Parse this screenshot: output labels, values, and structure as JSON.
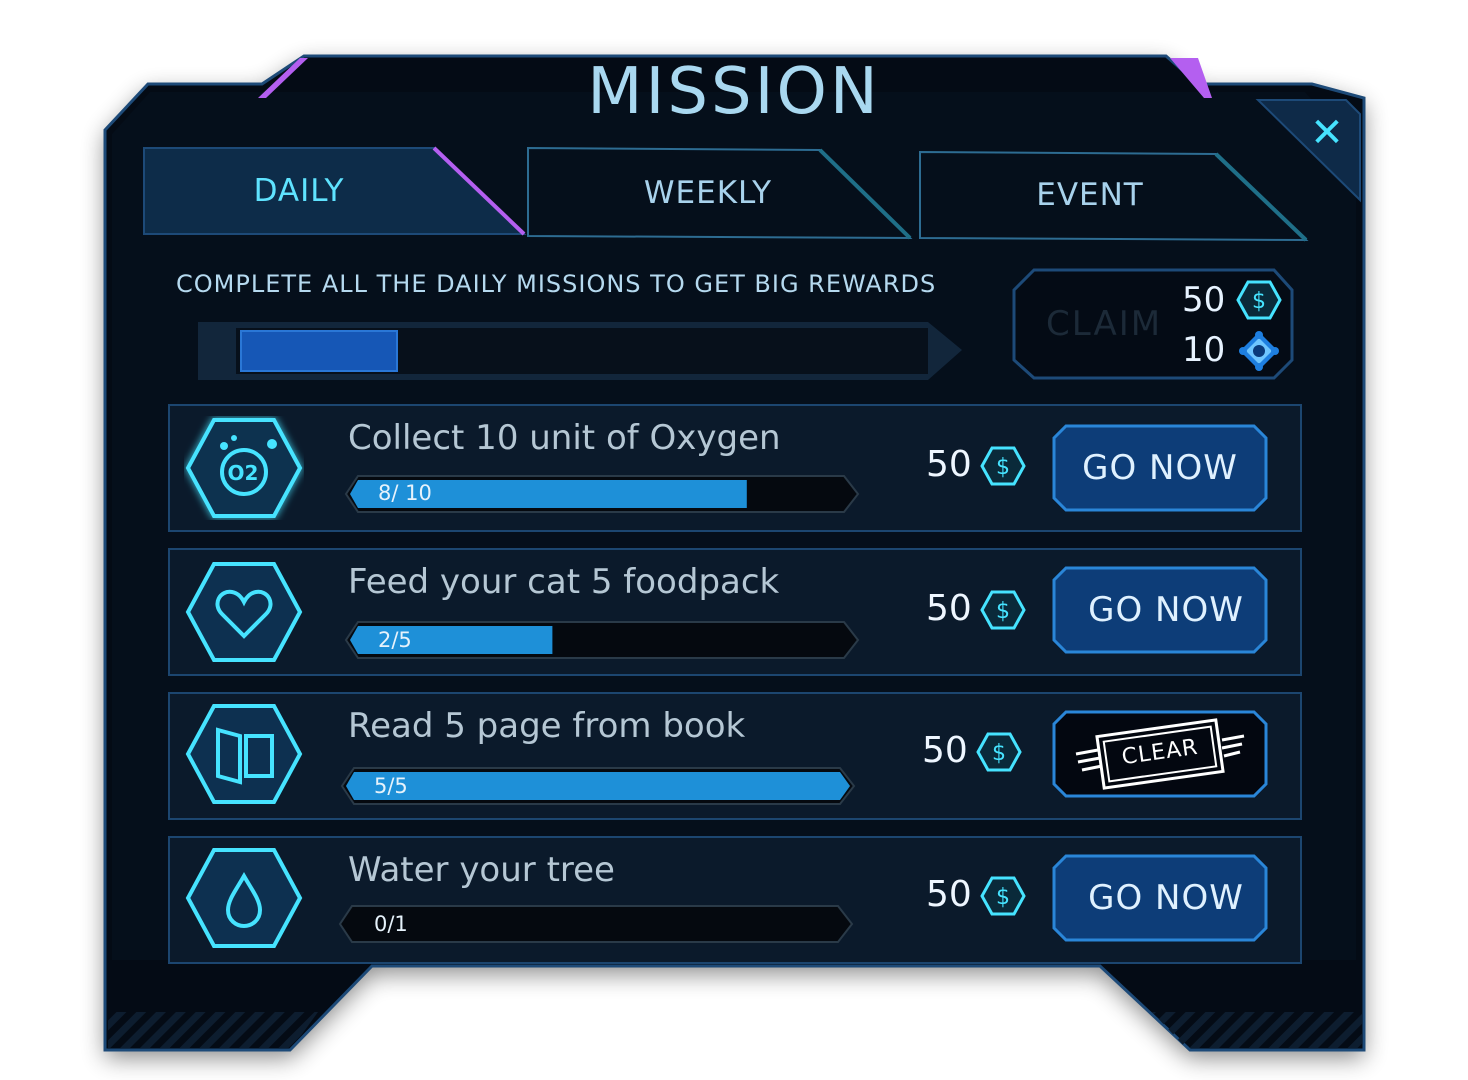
{
  "title": "MISSION",
  "close_icon": "close-icon",
  "tabs": [
    {
      "label": "DAILY",
      "active": true
    },
    {
      "label": "WEEKLY",
      "active": false
    },
    {
      "label": "EVENT",
      "active": false
    }
  ],
  "daily_banner": {
    "text": "COMPLETE ALL THE DAILY MISSIONS TO GET BIG REWARDS",
    "progress": 0.23
  },
  "claim": {
    "label": "CLAIM",
    "rewards": [
      {
        "amount": "50",
        "icon": "coin-icon"
      },
      {
        "amount": "10",
        "icon": "gem-icon"
      }
    ]
  },
  "missions": [
    {
      "title": "Collect 10 unit of Oxygen",
      "icon": "oxygen-icon",
      "progress_text": "8/ 10",
      "progress": 0.8,
      "reward": "50",
      "reward_icon": "coin-icon",
      "action": "GO NOW"
    },
    {
      "title": "Feed your cat 5 foodpack",
      "icon": "heart-icon",
      "progress_text": "2/5",
      "progress": 0.4,
      "reward": "50",
      "reward_icon": "coin-icon",
      "action": "GO NOW"
    },
    {
      "title": "Read 5 page from book",
      "icon": "book-icon",
      "progress_text": "5/5",
      "progress": 1.0,
      "reward": "50",
      "reward_icon": "coin-icon",
      "action": "CLEAR"
    },
    {
      "title": "Water your tree",
      "icon": "water-drop-icon",
      "progress_text": "0/1",
      "progress": 0.0,
      "reward": "50",
      "reward_icon": "coin-icon",
      "action": "GO NOW"
    }
  ],
  "colors": {
    "panel": "#040b15",
    "border": "#1d4a78",
    "accent_cyan": "#46e3ff",
    "accent_purple": "#b45ff0",
    "progress_fill": "#1e90d8",
    "button": "#0d3d78"
  }
}
